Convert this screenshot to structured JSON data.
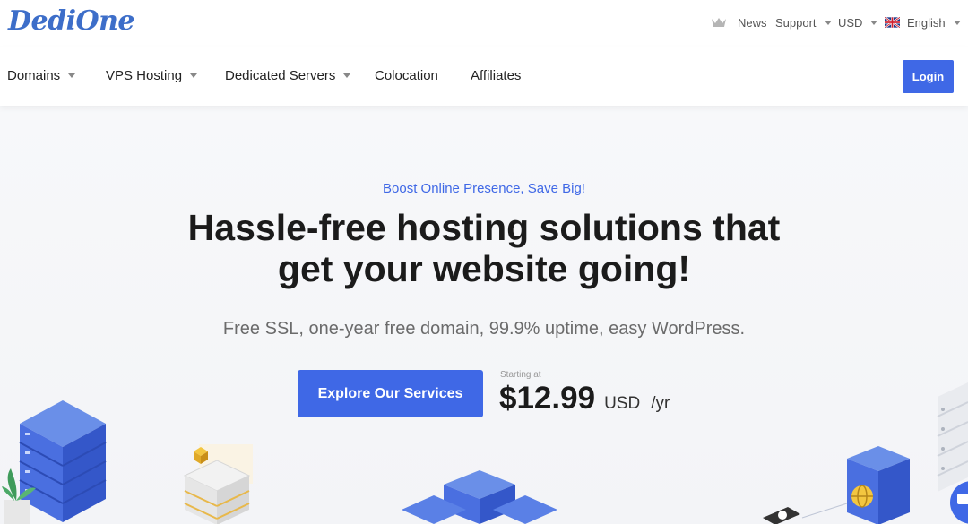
{
  "brand": {
    "logo_text": "DediOne",
    "accent_color": "#3f68e6",
    "logo_color": "#3d6ec9"
  },
  "utility_bar": {
    "news": {
      "icon": "crown-icon",
      "label": "News"
    },
    "support": {
      "label": "Support"
    },
    "currency": {
      "label": "USD"
    },
    "language": {
      "icon": "uk-flag-icon",
      "label": "English"
    }
  },
  "nav": {
    "items": [
      {
        "label": "Domains",
        "has_dropdown": true
      },
      {
        "label": "VPS Hosting",
        "has_dropdown": true
      },
      {
        "label": "Dedicated Servers",
        "has_dropdown": true
      },
      {
        "label": "Colocation",
        "has_dropdown": false
      },
      {
        "label": "Affiliates",
        "has_dropdown": false
      }
    ],
    "login_label": "Login"
  },
  "hero": {
    "tagline": "Boost Online Presence, Save Big!",
    "headline_line1": "Hassle-free hosting solutions that",
    "headline_line2": "get your website going!",
    "subline": "Free SSL, one-year free domain, 99.9% uptime, easy WordPress.",
    "cta_label": "Explore Our Services",
    "price": {
      "prefix": "Starting at",
      "amount": "$12.99",
      "currency": "USD",
      "period": "/yr"
    }
  }
}
